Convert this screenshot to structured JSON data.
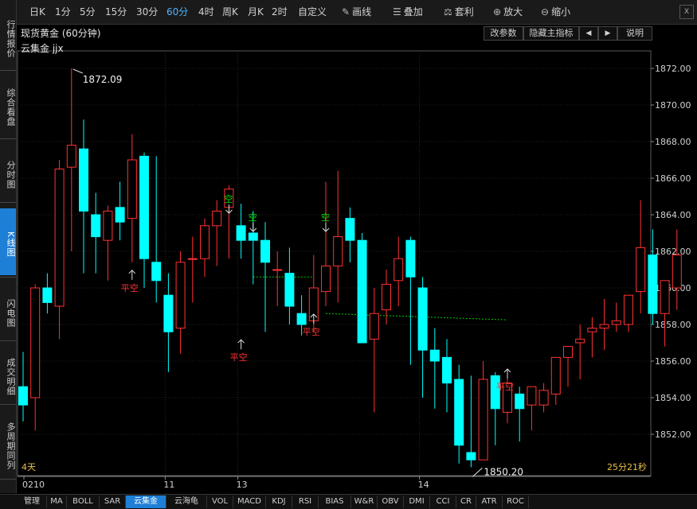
{
  "sidebar": {
    "items": [
      {
        "label": "行情报价",
        "active": false
      },
      {
        "label": "综合看盘",
        "active": false
      },
      {
        "label": "分时图",
        "active": false
      },
      {
        "label": "K线图",
        "active": true
      },
      {
        "label": "闪电图",
        "active": false
      },
      {
        "label": "成交明细",
        "active": false
      },
      {
        "label": "多周期同列",
        "active": false
      }
    ]
  },
  "toolbar": {
    "periods": [
      "日K",
      "1分",
      "5分",
      "15分",
      "30分",
      "60分",
      "4时",
      "周K",
      "月K",
      "2时",
      "自定义"
    ],
    "active_period": "60分",
    "draw_label": "画线",
    "overlay_label": "叠加",
    "arbitrage_label": "套利",
    "zoom_in_label": "放大",
    "zoom_out_label": "缩小",
    "close_label": "X"
  },
  "header": {
    "title": "现货黄金 (60分钟)",
    "subtitle": "云集金 jjx",
    "buttons": {
      "params": "改参数",
      "hide_main": "隐藏主指标",
      "prev": "◀",
      "next": "▶",
      "help": "说明"
    }
  },
  "chart_data": {
    "type": "candlestick",
    "ylim": [
      1850,
      1873
    ],
    "y_ticks": [
      "1852.00",
      "1854.00",
      "1856.00",
      "1858.00",
      "1860.00",
      "1862.00",
      "1864.00",
      "1866.00",
      "1868.00",
      "1870.00",
      "1872.00"
    ],
    "x_ticks": [
      "0210",
      "11",
      "13",
      "14"
    ],
    "x_tick_index": [
      0,
      12,
      18,
      33
    ],
    "candles": [
      {
        "o": 1854.6,
        "h": 1856.5,
        "l": 1852.7,
        "c": 1853.6
      },
      {
        "o": 1854.0,
        "h": 1860.2,
        "l": 1852.2,
        "c": 1860.0
      },
      {
        "o": 1860.0,
        "h": 1860.8,
        "l": 1858.6,
        "c": 1859.2
      },
      {
        "o": 1859.0,
        "h": 1867.0,
        "l": 1857.2,
        "c": 1866.5
      },
      {
        "o": 1866.6,
        "h": 1872.0,
        "l": 1862.0,
        "c": 1867.8
      },
      {
        "o": 1867.6,
        "h": 1869.2,
        "l": 1860.8,
        "c": 1864.2
      },
      {
        "o": 1864.0,
        "h": 1865.2,
        "l": 1860.8,
        "c": 1862.8
      },
      {
        "o": 1862.6,
        "h": 1864.5,
        "l": 1860.4,
        "c": 1864.2
      },
      {
        "o": 1864.4,
        "h": 1865.8,
        "l": 1862.6,
        "c": 1863.6
      },
      {
        "o": 1863.8,
        "h": 1868.4,
        "l": 1861.4,
        "c": 1867.0
      },
      {
        "o": 1867.2,
        "h": 1867.4,
        "l": 1860.0,
        "c": 1861.6
      },
      {
        "o": 1861.4,
        "h": 1867.2,
        "l": 1859.2,
        "c": 1860.4
      },
      {
        "o": 1859.6,
        "h": 1860.8,
        "l": 1855.4,
        "c": 1857.6
      },
      {
        "o": 1857.8,
        "h": 1862.0,
        "l": 1856.4,
        "c": 1861.4
      },
      {
        "o": 1861.6,
        "h": 1862.8,
        "l": 1859.2,
        "c": 1861.6
      },
      {
        "o": 1861.6,
        "h": 1863.8,
        "l": 1860.6,
        "c": 1863.4
      },
      {
        "o": 1863.4,
        "h": 1864.8,
        "l": 1861.2,
        "c": 1864.2
      },
      {
        "o": 1864.4,
        "h": 1865.6,
        "l": 1861.6,
        "c": 1865.4
      },
      {
        "o": 1863.4,
        "h": 1864.6,
        "l": 1861.6,
        "c": 1862.6
      },
      {
        "o": 1863.0,
        "h": 1864.2,
        "l": 1860.2,
        "c": 1862.6
      },
      {
        "o": 1862.6,
        "h": 1863.6,
        "l": 1857.6,
        "c": 1861.4
      },
      {
        "o": 1861.0,
        "h": 1862.0,
        "l": 1859.0,
        "c": 1861.0
      },
      {
        "o": 1860.8,
        "h": 1862.2,
        "l": 1858.0,
        "c": 1859.0
      },
      {
        "o": 1858.6,
        "h": 1859.6,
        "l": 1857.4,
        "c": 1858.0
      },
      {
        "o": 1858.2,
        "h": 1861.8,
        "l": 1857.6,
        "c": 1860.0
      },
      {
        "o": 1859.8,
        "h": 1865.8,
        "l": 1859.0,
        "c": 1861.2
      },
      {
        "o": 1861.2,
        "h": 1866.4,
        "l": 1859.2,
        "c": 1862.8
      },
      {
        "o": 1863.8,
        "h": 1864.4,
        "l": 1861.4,
        "c": 1862.6
      },
      {
        "o": 1862.6,
        "h": 1863.0,
        "l": 1857.4,
        "c": 1857.0
      },
      {
        "o": 1857.2,
        "h": 1860.0,
        "l": 1853.2,
        "c": 1858.6
      },
      {
        "o": 1858.8,
        "h": 1861.0,
        "l": 1858.0,
        "c": 1860.2
      },
      {
        "o": 1860.4,
        "h": 1862.8,
        "l": 1859.0,
        "c": 1861.6
      },
      {
        "o": 1862.6,
        "h": 1862.8,
        "l": 1855.8,
        "c": 1860.6
      },
      {
        "o": 1860.0,
        "h": 1860.6,
        "l": 1854.0,
        "c": 1856.6
      },
      {
        "o": 1856.6,
        "h": 1857.8,
        "l": 1853.4,
        "c": 1856.0
      },
      {
        "o": 1856.2,
        "h": 1857.2,
        "l": 1853.2,
        "c": 1854.8
      },
      {
        "o": 1855.0,
        "h": 1855.8,
        "l": 1850.4,
        "c": 1851.4
      },
      {
        "o": 1851.0,
        "h": 1855.2,
        "l": 1850.2,
        "c": 1850.6
      },
      {
        "o": 1850.6,
        "h": 1856.0,
        "l": 1850.6,
        "c": 1855.0
      },
      {
        "o": 1855.2,
        "h": 1855.4,
        "l": 1851.4,
        "c": 1853.4
      },
      {
        "o": 1853.2,
        "h": 1855.2,
        "l": 1852.6,
        "c": 1854.8
      },
      {
        "o": 1854.2,
        "h": 1854.6,
        "l": 1851.6,
        "c": 1853.4
      },
      {
        "o": 1853.6,
        "h": 1854.4,
        "l": 1852.2,
        "c": 1854.6
      },
      {
        "o": 1853.6,
        "h": 1854.8,
        "l": 1853.2,
        "c": 1854.4
      },
      {
        "o": 1854.2,
        "h": 1856.0,
        "l": 1853.6,
        "c": 1856.2
      },
      {
        "o": 1856.2,
        "h": 1856.6,
        "l": 1854.6,
        "c": 1856.8
      },
      {
        "o": 1857.0,
        "h": 1858.0,
        "l": 1855.0,
        "c": 1857.2
      },
      {
        "o": 1857.6,
        "h": 1858.4,
        "l": 1856.2,
        "c": 1857.8
      },
      {
        "o": 1857.8,
        "h": 1859.4,
        "l": 1856.6,
        "c": 1858.0
      },
      {
        "o": 1858.0,
        "h": 1859.2,
        "l": 1857.6,
        "c": 1858.2
      },
      {
        "o": 1858.0,
        "h": 1859.6,
        "l": 1857.6,
        "c": 1859.6
      },
      {
        "o": 1859.8,
        "h": 1864.8,
        "l": 1858.6,
        "c": 1862.2
      },
      {
        "o": 1861.8,
        "h": 1863.2,
        "l": 1858.0,
        "c": 1858.6
      },
      {
        "o": 1858.6,
        "h": 1859.8,
        "l": 1856.8,
        "c": 1860.4
      },
      {
        "o": 1860.0,
        "h": 1863.2,
        "l": 1858.8,
        "c": 1861.8
      }
    ],
    "max_label": "1872.09",
    "min_label": "1850.20",
    "max_index": 4,
    "min_index": 37,
    "signals": [
      {
        "index": 9,
        "label": "平空",
        "type": "cover",
        "price": 1861.4
      },
      {
        "index": 17,
        "label": "空",
        "type": "short",
        "price": 1864.0
      },
      {
        "index": 19,
        "label": "空",
        "type": "short",
        "price": 1863.0
      },
      {
        "index": 18,
        "label": "平空",
        "type": "cover",
        "price": 1857.6
      },
      {
        "index": 24,
        "label": "平空",
        "type": "cover",
        "price": 1859.0
      },
      {
        "index": 25,
        "label": "空",
        "type": "short",
        "price": 1863.0
      },
      {
        "index": 40,
        "label": "平空",
        "type": "cover",
        "price": 1856.0
      }
    ],
    "lines": [
      {
        "from_index": 19,
        "to_index": 24,
        "price": 1860.6
      },
      {
        "from_index": 25,
        "to_index": 40,
        "price": 1858.6
      }
    ],
    "left_label": "4天",
    "right_label": "25分21秒",
    "colors": {
      "up": "#ff3232",
      "down": "#00ffff",
      "signal_cover": "#ff3232",
      "signal_short": "#00e600",
      "dash": "#00cc00"
    }
  },
  "bottom_tabs": [
    {
      "label": "管理",
      "active": false
    },
    {
      "label": "MA",
      "active": false
    },
    {
      "label": "BOLL",
      "active": false
    },
    {
      "label": "SAR",
      "active": false
    },
    {
      "label": "云集金",
      "active": true
    },
    {
      "label": "云海龟",
      "active": false
    },
    {
      "label": "VOL",
      "active": false
    },
    {
      "label": "MACD",
      "active": false
    },
    {
      "label": "KDJ",
      "active": false
    },
    {
      "label": "RSI",
      "active": false
    },
    {
      "label": "BIAS",
      "active": false
    },
    {
      "label": "W&R",
      "active": false
    },
    {
      "label": "OBV",
      "active": false
    },
    {
      "label": "DMI",
      "active": false
    },
    {
      "label": "CCI",
      "active": false
    },
    {
      "label": "CR",
      "active": false
    },
    {
      "label": "ATR",
      "active": false
    },
    {
      "label": "ROC",
      "active": false
    }
  ]
}
